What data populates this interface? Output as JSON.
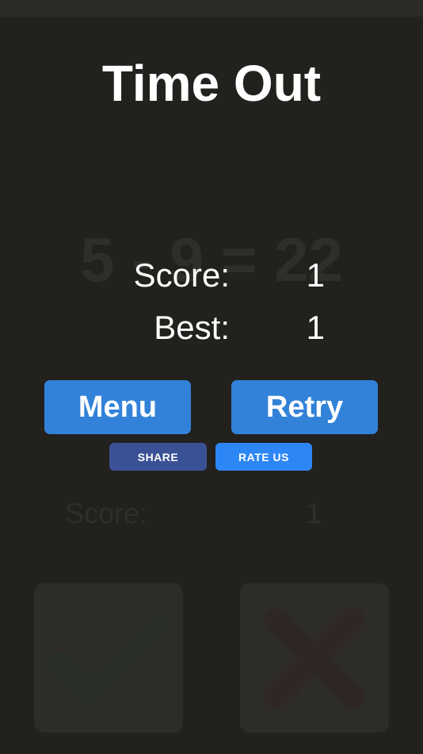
{
  "title": "Time Out",
  "background_equation": "5 - 9 = 22",
  "results": {
    "score_label": "Score:",
    "score_value": "1",
    "best_label": "Best:",
    "best_value": "1"
  },
  "buttons": {
    "menu_label": "Menu",
    "retry_label": "Retry",
    "share_label": "SHARE",
    "rate_label": "RATE US"
  },
  "background_score": {
    "label": "Score:",
    "value": "1"
  },
  "answer_buttons": {
    "correct_icon": "check-icon",
    "wrong_icon": "cross-icon"
  },
  "colors": {
    "background": "#22211e",
    "primary_button": "#3282d9",
    "share_button": "#3b5196",
    "rate_button": "#2d86f5"
  }
}
